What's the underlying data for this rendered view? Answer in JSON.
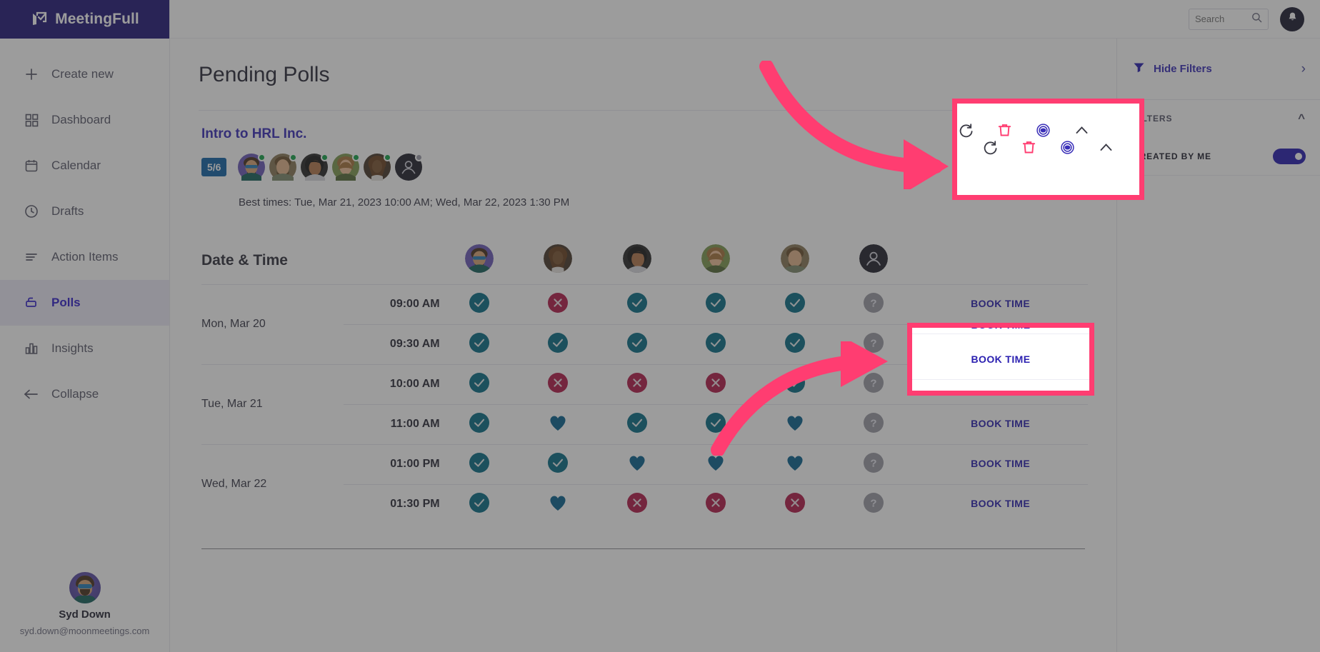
{
  "brand": {
    "name": "MeetingFull",
    "logo_icon": "meetingfull-logo",
    "bar_color": "#231a7a"
  },
  "sidebar": {
    "items": [
      {
        "label": "Create new",
        "icon": "plus-icon",
        "active": false
      },
      {
        "label": "Dashboard",
        "icon": "grid-icon",
        "active": false
      },
      {
        "label": "Calendar",
        "icon": "calendar-icon",
        "active": false
      },
      {
        "label": "Drafts",
        "icon": "clock-icon",
        "active": false
      },
      {
        "label": "Action Items",
        "icon": "list-icon",
        "active": false
      },
      {
        "label": "Polls",
        "icon": "poll-icon",
        "active": true
      },
      {
        "label": "Insights",
        "icon": "bar-chart-icon",
        "active": false
      },
      {
        "label": "Collapse",
        "icon": "arrow-left-icon",
        "active": false
      }
    ],
    "user": {
      "name": "Syd Down",
      "email": "syd.down@moonmeetings.com",
      "avatar": "user-avatar"
    }
  },
  "topbar": {
    "search": {
      "placeholder": "Search",
      "value": "",
      "icon": "search-icon"
    },
    "notifications_icon": "bell-icon"
  },
  "page": {
    "title": "Pending Polls"
  },
  "poll": {
    "name": "Intro to HRL Inc.",
    "response_badge": "5/6",
    "best_times_label": "Best times: Tue, Mar 21, 2023 10:00 AM; Wed, Mar 22, 2023 1:30 PM",
    "attendees": [
      {
        "name": "attendee-1",
        "status": "online"
      },
      {
        "name": "attendee-2",
        "status": "online"
      },
      {
        "name": "attendee-3",
        "status": "online"
      },
      {
        "name": "attendee-4",
        "status": "online"
      },
      {
        "name": "attendee-5",
        "status": "online"
      },
      {
        "name": "attendee-6",
        "status": "offline"
      }
    ],
    "actions": [
      {
        "name": "refresh",
        "icon": "refresh-icon",
        "color": "#3b3b46"
      },
      {
        "name": "delete",
        "icon": "trash-icon",
        "color": "#ff3d71"
      },
      {
        "name": "view",
        "icon": "eye-icon",
        "color": "#3a2fb8"
      },
      {
        "name": "collapse",
        "icon": "chevron-up-icon",
        "color": "#3b3b46"
      }
    ]
  },
  "table": {
    "header_label": "Date & Time",
    "book_label": "BOOK TIME",
    "columns": [
      "voter-1",
      "voter-2",
      "voter-3",
      "voter-4",
      "voter-5",
      "voter-6"
    ],
    "rows": [
      {
        "day": "Mon, Mar 20",
        "day_span": 2,
        "time": "09:00 AM",
        "votes": [
          "yes",
          "no",
          "yes",
          "yes",
          "yes",
          "none"
        ]
      },
      {
        "day": "",
        "day_span": 0,
        "time": "09:30 AM",
        "votes": [
          "yes",
          "yes",
          "yes",
          "yes",
          "yes",
          "none"
        ]
      },
      {
        "day": "Tue, Mar 21",
        "day_span": 2,
        "time": "10:00 AM",
        "votes": [
          "yes",
          "no",
          "no",
          "no",
          "yes",
          "none"
        ]
      },
      {
        "day": "",
        "day_span": 0,
        "time": "11:00 AM",
        "votes": [
          "yes",
          "fav",
          "yes",
          "yes",
          "fav",
          "none"
        ]
      },
      {
        "day": "Wed, Mar 22",
        "day_span": 2,
        "time": "01:00 PM",
        "votes": [
          "yes",
          "yes",
          "fav",
          "fav",
          "fav",
          "none"
        ]
      },
      {
        "day": "",
        "day_span": 0,
        "time": "01:30 PM",
        "votes": [
          "yes",
          "fav",
          "no",
          "no",
          "no",
          "none"
        ]
      }
    ],
    "legend": {
      "yes": "available",
      "no": "unavailable",
      "fav": "preferred",
      "none": "no-response"
    }
  },
  "filters": {
    "hide_filters_label": "Hide Filters",
    "hide_filters_icon": "funnel-icon",
    "expand_icon": "chevron-right-icon",
    "section_title": "FILTERS",
    "section_collapse_icon": "chevron-up-icon",
    "rows": [
      {
        "label": "CREATED BY ME",
        "enabled": true
      }
    ]
  },
  "colors": {
    "brand_purple": "#231a7a",
    "link_purple": "#3a2fb8",
    "yes_teal": "#0a6e87",
    "no_crimson": "#b31e4b",
    "fav_blue": "#0c6590",
    "none_gray": "#9b9ba6",
    "highlight_pink": "#ff3d71",
    "badge_blue": "#1565a8"
  }
}
